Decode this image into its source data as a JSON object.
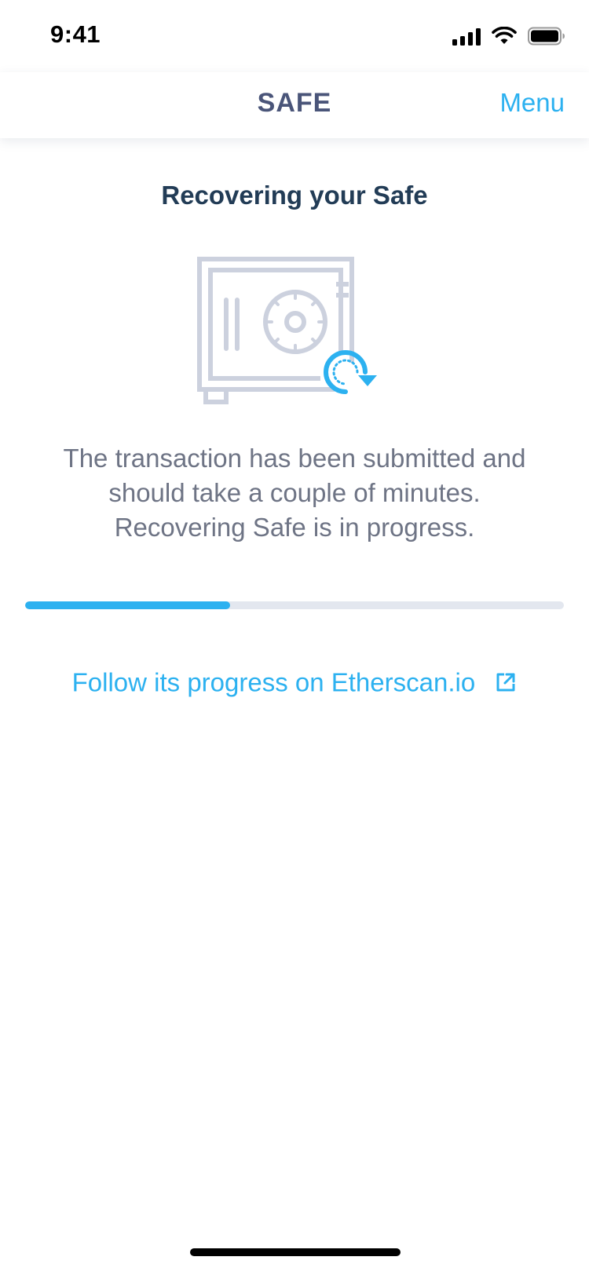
{
  "status_bar": {
    "time": "9:41",
    "icons": [
      "cellular-signal-icon",
      "wifi-icon",
      "battery-icon"
    ]
  },
  "nav": {
    "title": "SAFE",
    "menu_label": "Menu"
  },
  "main": {
    "title": "Recovering your Safe",
    "illustration": "safe-recovery-icon",
    "description_lines": [
      "The transaction has been submitted and",
      "should take a couple of minutes.",
      "Recovering Safe is in progress."
    ],
    "progress": 0.38,
    "link_label": "Follow its progress on Etherscan.io",
    "link_icon": "external-link-icon"
  },
  "colors": {
    "accent": "#2cb1f0",
    "nav_title": "#4a5579",
    "heading": "#223c56",
    "body_text": "#6e7485",
    "illustration_gray": "#ccd1de",
    "progress_track": "#e3e7ef"
  }
}
